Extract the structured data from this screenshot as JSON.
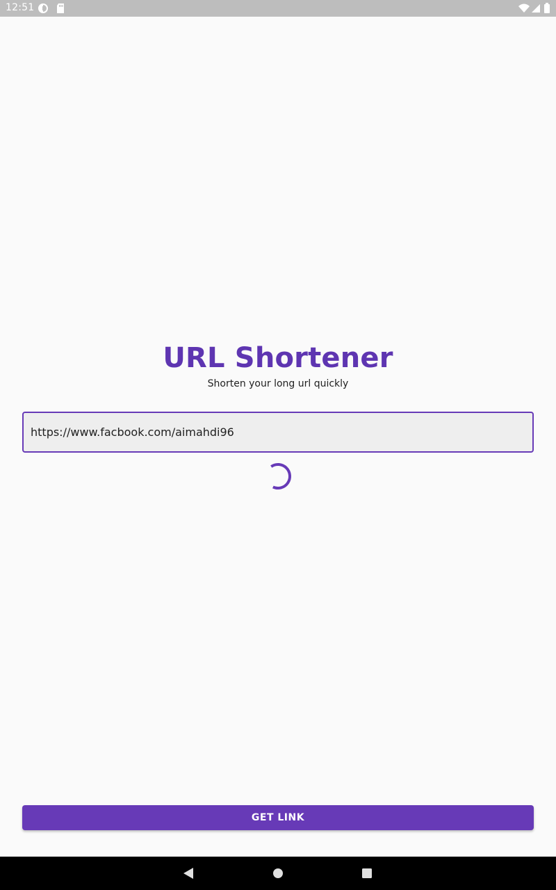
{
  "status_bar": {
    "time": "12:51",
    "icons": [
      "data-saver-icon",
      "sd-card-icon",
      "wifi-icon",
      "signal-icon",
      "battery-icon"
    ]
  },
  "main": {
    "title": "URL Shortener",
    "subtitle": "Shorten your long url quickly",
    "url_input": {
      "value": "https://www.facbook.com/aimahdi96",
      "placeholder": ""
    },
    "loading": true
  },
  "action": {
    "get_link_label": "GET LINK"
  },
  "nav_bar": {
    "buttons": [
      "back-icon",
      "home-icon",
      "recents-icon"
    ]
  },
  "colors": {
    "accent": "#673ab7",
    "title": "#5e35b1",
    "status_bar": "#bdbdbd",
    "nav_bar": "#000000",
    "background": "#fafafa",
    "input_fill": "#eeeeee"
  }
}
